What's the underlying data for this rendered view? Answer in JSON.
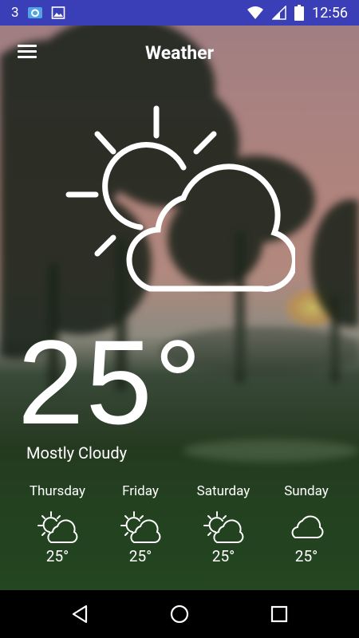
{
  "status_bar": {
    "signal_label": "3",
    "time": "12:56",
    "icons": [
      "sync-notification-icon",
      "image-notification-icon",
      "wifi-icon",
      "cell-signal-icon",
      "battery-icon"
    ]
  },
  "header": {
    "title": "Weather",
    "menu_icon": "hamburger-menu-icon"
  },
  "current": {
    "temperature": "25°",
    "condition": "Mostly Cloudy",
    "icon": "partly-cloudy-icon"
  },
  "forecast": [
    {
      "day": "Thursday",
      "temp": "25°",
      "icon": "partly-cloudy-icon"
    },
    {
      "day": "Friday",
      "temp": "25°",
      "icon": "partly-cloudy-icon"
    },
    {
      "day": "Saturday",
      "temp": "25°",
      "icon": "partly-cloudy-icon"
    },
    {
      "day": "Sunday",
      "temp": "25°",
      "icon": "cloud-icon"
    }
  ],
  "nav_bar": {
    "icons": [
      "back-icon",
      "home-icon",
      "recents-icon"
    ]
  },
  "colors": {
    "status_bar": "#3a3fb8",
    "nav_bar": "#000000",
    "text": "#ffffff"
  }
}
